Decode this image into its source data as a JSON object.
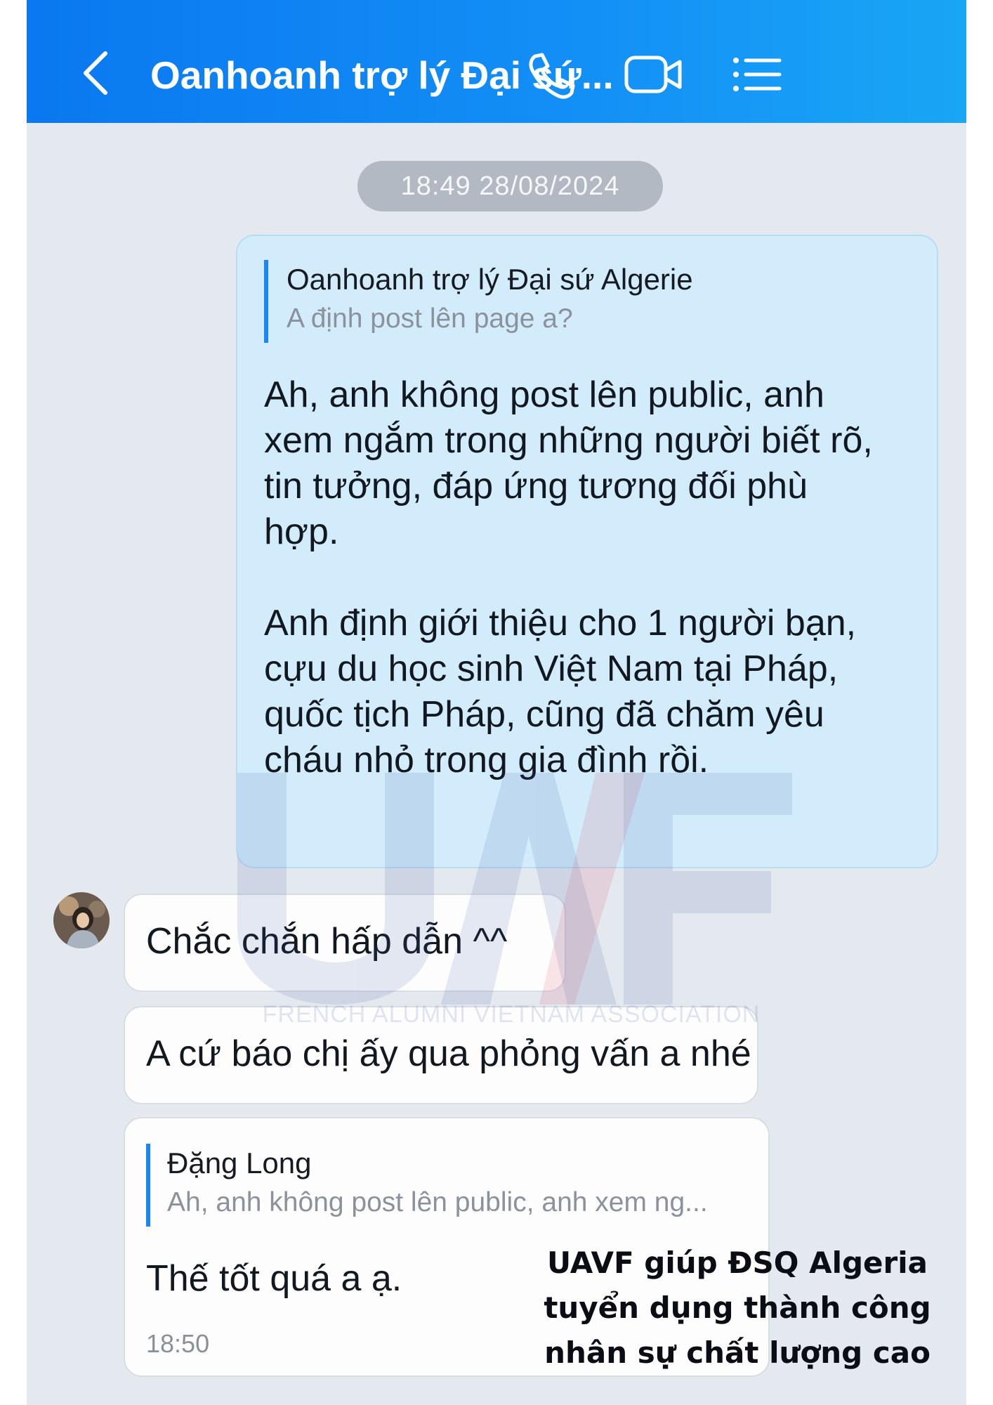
{
  "header": {
    "title": "Oanhoanh trợ lý Đại sứ...",
    "back_icon": "chevron-left-icon",
    "call_icon": "phone-icon",
    "video_icon": "video-camera-icon",
    "menu_icon": "list-menu-icon",
    "color": "#0a78f0"
  },
  "date_separator": "18:49 28/08/2024",
  "messages": [
    {
      "direction": "outgoing",
      "quote": {
        "name": "Oanhoanh trợ lý Đại sứ Algerie",
        "text": "A định post lên page a?"
      },
      "lines": [
        "Ah, anh không post lên public, anh",
        "xem ngắm trong những người biết rõ,",
        "tin tưởng, đáp ứng tương đối phù",
        "hợp.",
        "",
        "Anh định giới thiệu cho 1 người bạn,",
        "cựu du học sinh Việt Nam tại Pháp,",
        "quốc tịch Pháp, cũng đã chăm yêu",
        "cháu nhỏ trong gia đình rồi."
      ]
    },
    {
      "direction": "incoming",
      "text": "Chắc chắn hấp dẫn ^^"
    },
    {
      "direction": "incoming",
      "text": "A cứ báo chị ấy qua phỏng vấn a nhé"
    },
    {
      "direction": "incoming",
      "quote": {
        "name": "Đặng Long",
        "text": "Ah, anh không post lên public, anh xem ng..."
      },
      "text": "Thế tốt quá a ạ.",
      "time": "18:50"
    }
  ],
  "watermark": {
    "logo": "UAVF",
    "subtitle": "FRENCH ALUMNI VIETNAM ASSOCIATION"
  },
  "caption": {
    "line1": "UAVF giúp ĐSQ Algeria",
    "line2": "tuyển dụng thành công",
    "line3": "nhân sự chất lượng cao"
  }
}
